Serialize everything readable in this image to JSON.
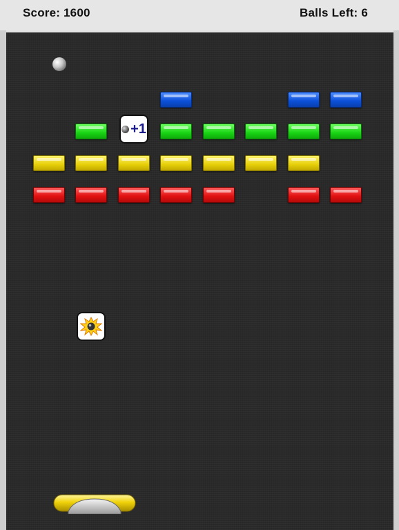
{
  "hud": {
    "score_text": "Score: 1600",
    "balls_left_text": "Balls Left: 6"
  },
  "powerups": {
    "extra_ball_label": "+1",
    "extra_ball_icon": "ball-plus-one-icon",
    "explosive_ball_icon": "explosive-ball-icon"
  },
  "bricks": {
    "row1_blue": [
      "blue-brick",
      "blue-brick",
      "blue-brick"
    ],
    "row2_green": [
      "green-brick",
      "green-brick",
      "green-brick",
      "green-brick",
      "green-brick",
      "green-brick"
    ],
    "row3_yellow": [
      "yellow-brick",
      "yellow-brick",
      "yellow-brick",
      "yellow-brick",
      "yellow-brick",
      "yellow-brick",
      "yellow-brick"
    ],
    "row4_red": [
      "red-brick",
      "red-brick",
      "red-brick",
      "red-brick",
      "red-brick",
      "red-brick",
      "red-brick"
    ]
  },
  "colors": {
    "playfield": "#2a2a2a",
    "blue": "#0b4fd8",
    "green": "#18d414",
    "yellow": "#e6cf08",
    "red": "#e01010",
    "paddle": "#f0d20a"
  }
}
